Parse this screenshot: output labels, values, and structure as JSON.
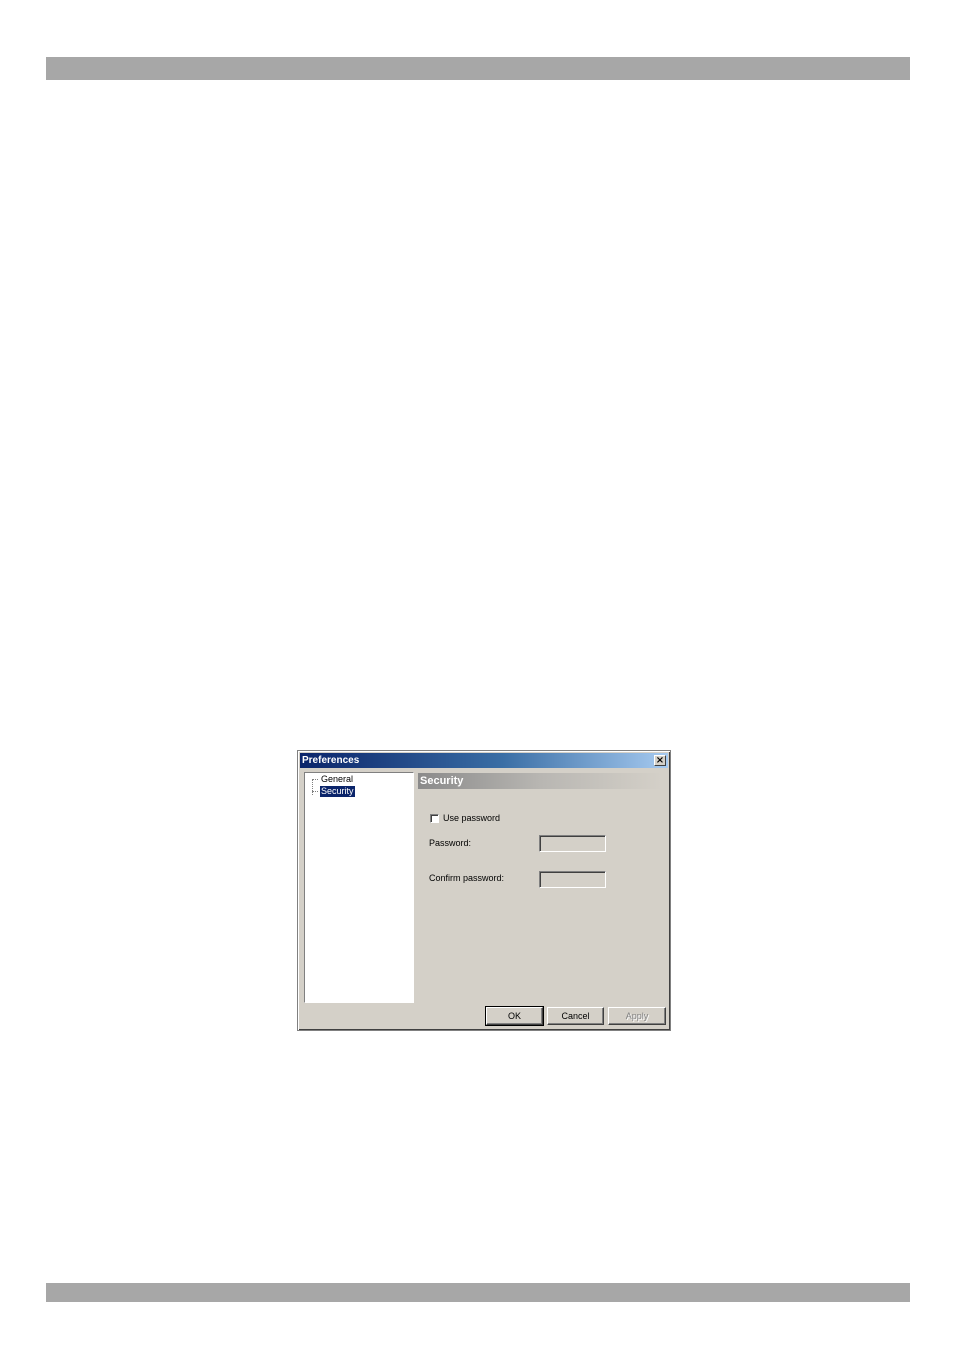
{
  "dialog": {
    "title": "Preferences",
    "close_symbol": "×",
    "tree": {
      "items": [
        {
          "label": "General",
          "selected": false
        },
        {
          "label": "Security",
          "selected": true
        }
      ]
    },
    "section": {
      "title": "Security",
      "use_password_label": "Use password",
      "use_password_checked": false,
      "password_label": "Password:",
      "password_value": "",
      "confirm_label": "Confirm password:",
      "confirm_value": ""
    },
    "buttons": {
      "ok": "OK",
      "cancel": "Cancel",
      "apply": "Apply"
    }
  },
  "colors": {
    "titlebar_start": "#0a246a",
    "titlebar_end": "#a6caf0",
    "dialog_face": "#d4d0c8",
    "page_bar": "#a7a7a7",
    "selection": "#0a246a"
  }
}
